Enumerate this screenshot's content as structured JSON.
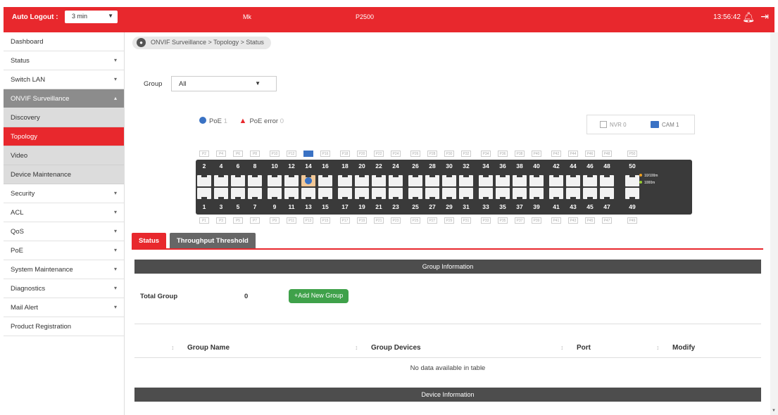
{
  "topbar": {
    "auto_logout_label": "Auto Logout :",
    "auto_logout_value": "3 min",
    "model": "Mk",
    "product": "P2500",
    "time": "13:56:42"
  },
  "sidebar": {
    "items": [
      {
        "label": "Dashboard"
      },
      {
        "label": "Status"
      },
      {
        "label": "Switch LAN"
      },
      {
        "label": "ONVIF Surveillance"
      },
      {
        "label": "Discovery"
      },
      {
        "label": "Topology"
      },
      {
        "label": "Video"
      },
      {
        "label": "Device Maintenance"
      },
      {
        "label": "Security"
      },
      {
        "label": "ACL"
      },
      {
        "label": "QoS"
      },
      {
        "label": "PoE"
      },
      {
        "label": "System Maintenance"
      },
      {
        "label": "Diagnostics"
      },
      {
        "label": "Mail Alert"
      },
      {
        "label": "Product Registration"
      }
    ]
  },
  "breadcrumb": "ONVIF Surveillance > Topology > Status",
  "group": {
    "label": "Group",
    "value": "All"
  },
  "legend": {
    "poe": "PoE",
    "poe_count": "1",
    "poe_error": "PoE error",
    "poe_error_count": "0"
  },
  "devices": {
    "nvr": "NVR 0",
    "cam": "CAM 1"
  },
  "switch": {
    "top_labels": [
      "P2",
      "P4",
      "P6",
      "P8",
      "P10",
      "P12",
      "",
      "P16",
      "P18",
      "P20",
      "P22",
      "P24",
      "P26",
      "P28",
      "P30",
      "P32",
      "P34",
      "P36",
      "P38",
      "P40",
      "P42",
      "P44",
      "P46",
      "P48",
      "P50"
    ],
    "bottom_labels": [
      "P1",
      "P3",
      "P5",
      "P7",
      "P9",
      "P11",
      "P13",
      "P15",
      "P17",
      "P19",
      "P21",
      "P23",
      "P25",
      "P27",
      "P29",
      "P31",
      "P33",
      "P35",
      "P37",
      "P39",
      "P41",
      "P43",
      "P45",
      "P47",
      "P49"
    ],
    "top_nums": [
      "2",
      "4",
      "6",
      "8",
      "10",
      "12",
      "14",
      "16",
      "18",
      "20",
      "22",
      "24",
      "26",
      "28",
      "30",
      "32",
      "34",
      "36",
      "38",
      "40",
      "42",
      "44",
      "46",
      "48",
      "50"
    ],
    "bottom_nums": [
      "1",
      "3",
      "5",
      "7",
      "9",
      "11",
      "13",
      "15",
      "17",
      "19",
      "21",
      "23",
      "25",
      "27",
      "29",
      "31",
      "33",
      "35",
      "37",
      "39",
      "41",
      "43",
      "45",
      "47",
      "49"
    ],
    "speed_a": "10/100m",
    "speed_b": "1000m"
  },
  "tabs": {
    "status": "Status",
    "throughput": "Throughput Threshold"
  },
  "group_info": {
    "header": "Group Information",
    "total_label": "Total Group",
    "total_value": "0",
    "add_button": "+Add New Group"
  },
  "table": {
    "columns": [
      "Group Name",
      "Group Devices",
      "Port",
      "Modify"
    ],
    "empty": "No data available in table"
  },
  "device_info": {
    "header": "Device Information"
  },
  "colors": {
    "accent": "#e8282d",
    "add_green": "#3fa14a",
    "poe_blue": "#3a72c4"
  }
}
